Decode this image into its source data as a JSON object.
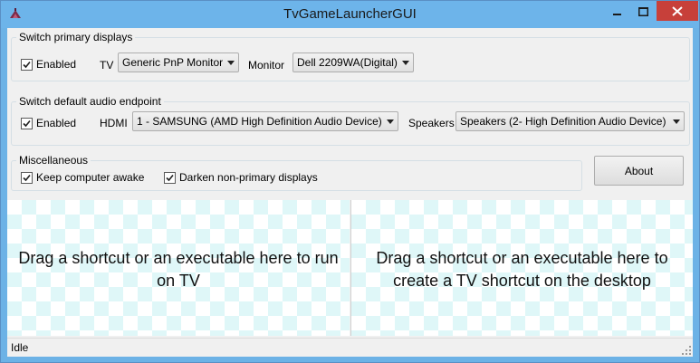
{
  "window": {
    "title": "TvGameLauncherGUI"
  },
  "displays": {
    "legend": "Switch primary displays",
    "enabled_label": "Enabled",
    "enabled_checked": true,
    "tv_label": "TV",
    "tv_value": "Generic PnP Monitor",
    "monitor_label": "Monitor",
    "monitor_value": "Dell 2209WA(Digital)"
  },
  "audio": {
    "legend": "Switch default audio endpoint",
    "enabled_label": "Enabled",
    "enabled_checked": true,
    "hdmi_label": "HDMI",
    "hdmi_value": "1 - SAMSUNG (AMD High Definition Audio Device)",
    "speakers_label": "Speakers",
    "speakers_value": "Speakers (2- High Definition Audio Device)"
  },
  "misc": {
    "legend": "Miscellaneous",
    "keep_awake_label": "Keep computer awake",
    "keep_awake_checked": true,
    "darken_label": "Darken non-primary displays",
    "darken_checked": true
  },
  "about_button": "About",
  "drop_zones": {
    "left": "Drag a shortcut or an executable here to run on TV",
    "right": "Drag a shortcut or an executable here to create a TV shortcut on the desktop"
  },
  "status": "Idle",
  "colors": {
    "titlebar": "#6db4ea",
    "close_button": "#c7403a",
    "checker": "#dff7f8"
  }
}
